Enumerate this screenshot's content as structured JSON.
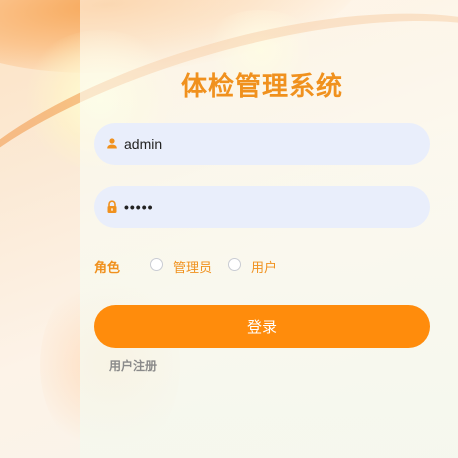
{
  "app": {
    "title": "体检管理系统"
  },
  "login_form": {
    "username": {
      "value": "admin",
      "icon": "user-icon"
    },
    "password": {
      "value": "•••••",
      "icon": "lock-icon"
    },
    "role": {
      "label": "角色",
      "options": [
        "管理员",
        "用户"
      ],
      "selected": null
    },
    "submit_label": "登录",
    "register_label": "用户注册"
  },
  "colors": {
    "accent": "#f0911e",
    "button": "#ff8c0c",
    "input_bg": "#e9eefb",
    "link": "#8a8a8a"
  }
}
